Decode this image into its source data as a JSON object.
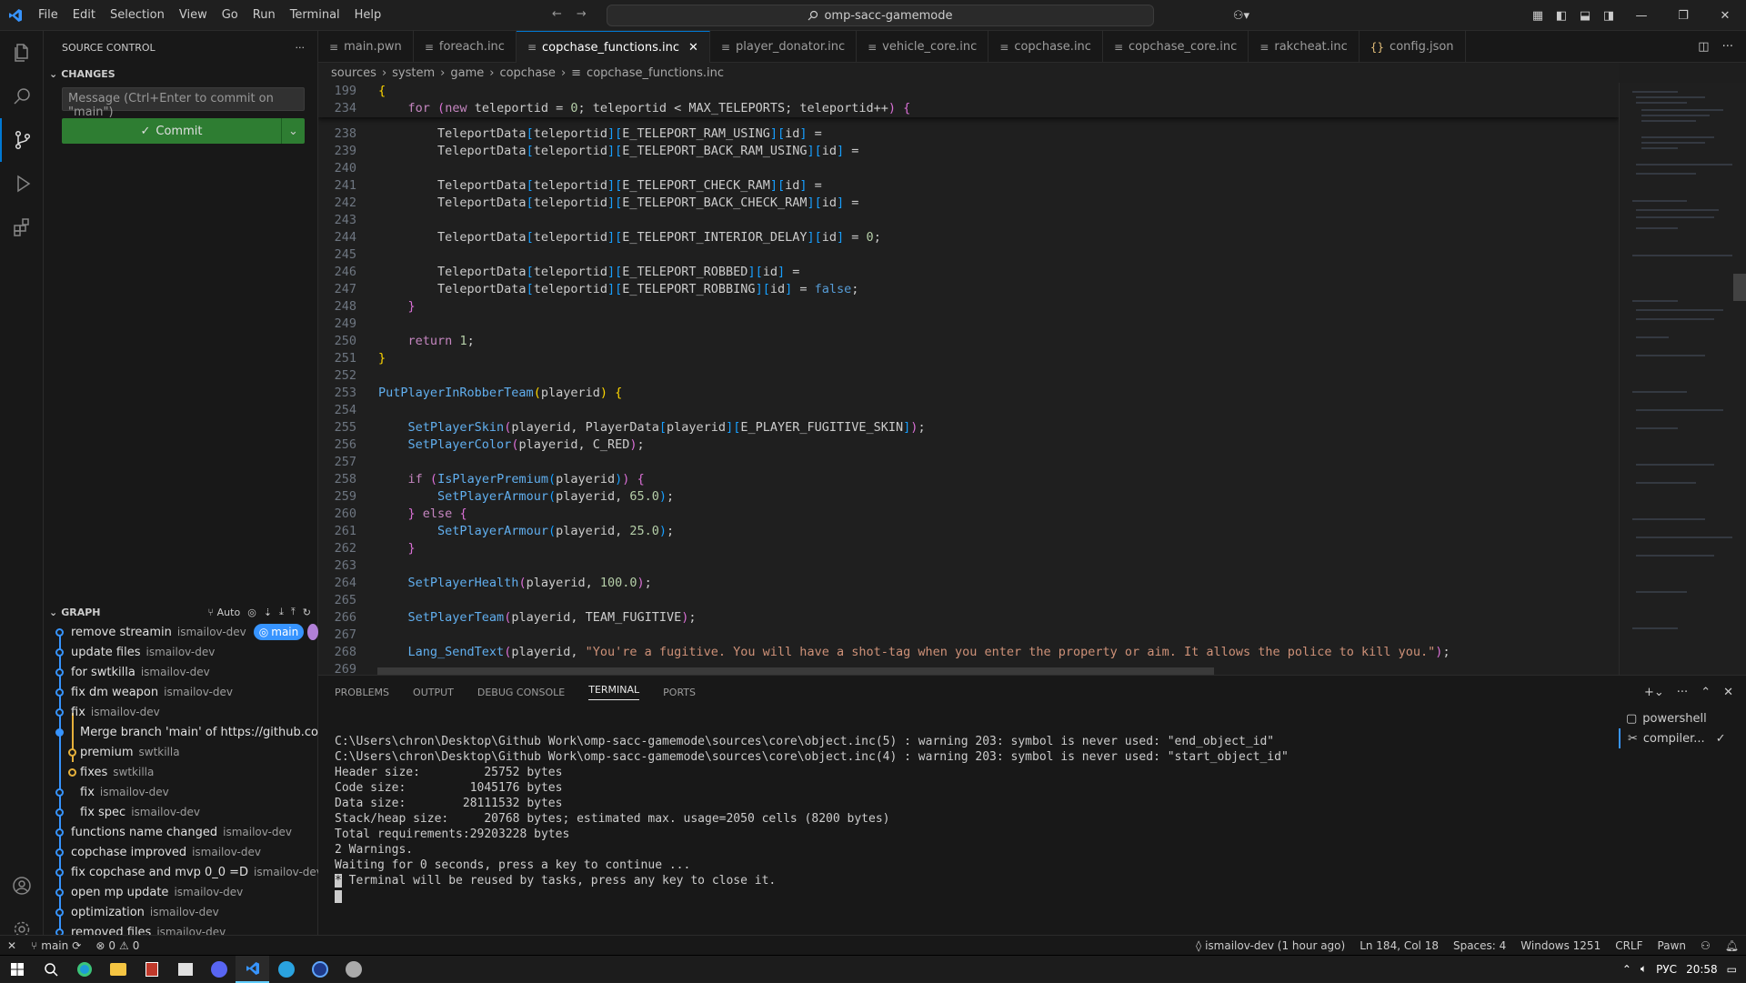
{
  "menu": [
    "File",
    "Edit",
    "Selection",
    "View",
    "Go",
    "Run",
    "Terminal",
    "Help"
  ],
  "search": {
    "text": "omp-sacc-gamemode"
  },
  "sidebar": {
    "title": "SOURCE CONTROL",
    "changes_label": "CHANGES",
    "message_placeholder": "Message (Ctrl+Enter to commit on \"main\")",
    "commit_label": "Commit",
    "graph_label": "GRAPH",
    "graph_auto": "Auto",
    "branch_badge": "main",
    "commits": [
      {
        "msg": "remove streamin",
        "author": "ismailov-dev"
      },
      {
        "msg": "update files",
        "author": "ismailov-dev"
      },
      {
        "msg": "for swtkilla",
        "author": "ismailov-dev"
      },
      {
        "msg": "fix dm weapon",
        "author": "ismailov-dev"
      },
      {
        "msg": "fix",
        "author": "ismailov-dev"
      },
      {
        "msg": "Merge branch 'main' of https://github.co...",
        "author": ""
      },
      {
        "msg": "premium",
        "author": "swtkilla"
      },
      {
        "msg": "fixes",
        "author": "swtkilla"
      },
      {
        "msg": "fix",
        "author": "ismailov-dev"
      },
      {
        "msg": "fix spec",
        "author": "ismailov-dev"
      },
      {
        "msg": "functions name changed",
        "author": "ismailov-dev"
      },
      {
        "msg": "copchase improved",
        "author": "ismailov-dev"
      },
      {
        "msg": "fix copchase and mvp 0_0 =D",
        "author": "ismailov-dev"
      },
      {
        "msg": "open mp update",
        "author": "ismailov-dev"
      },
      {
        "msg": "optimization",
        "author": "ismailov-dev"
      },
      {
        "msg": "removed files",
        "author": "ismailov-dev"
      }
    ]
  },
  "tabs": [
    {
      "label": "main.pwn",
      "icon": "≡"
    },
    {
      "label": "foreach.inc",
      "icon": "≡"
    },
    {
      "label": "copchase_functions.inc",
      "icon": "≡",
      "active": true
    },
    {
      "label": "player_donator.inc",
      "icon": "≡"
    },
    {
      "label": "vehicle_core.inc",
      "icon": "≡"
    },
    {
      "label": "copchase.inc",
      "icon": "≡"
    },
    {
      "label": "copchase_core.inc",
      "icon": "≡"
    },
    {
      "label": "rakcheat.inc",
      "icon": "≡"
    },
    {
      "label": "config.json",
      "icon": "{}"
    }
  ],
  "breadcrumb": [
    "sources",
    "system",
    "game",
    "copchase",
    "copchase_functions.inc"
  ],
  "panel": {
    "tabs": [
      "PROBLEMS",
      "OUTPUT",
      "DEBUG CONSOLE",
      "TERMINAL",
      "PORTS"
    ],
    "terminal_lines": [
      "C:\\Users\\chron\\Desktop\\Github Work\\omp-sacc-gamemode\\sources\\core\\object.inc(5) : warning 203: symbol is never used: \"end_object_id\"",
      "C:\\Users\\chron\\Desktop\\Github Work\\omp-sacc-gamemode\\sources\\core\\object.inc(4) : warning 203: symbol is never used: \"start_object_id\"",
      "Header size:         25752 bytes",
      "Code size:         1045176 bytes",
      "Data size:        28111532 bytes",
      "Stack/heap size:     20768 bytes; estimated max. usage=2050 cells (8200 bytes)",
      "Total requirements:29203228 bytes",
      "",
      "2 Warnings.",
      "",
      "Waiting for 0 seconds, press a key to continue ...",
      " Terminal will be reused by tasks, press any key to close it."
    ],
    "terminals": [
      "powershell",
      "compiler..."
    ]
  },
  "status": {
    "branch": "main",
    "errors": "0",
    "warnings": "0",
    "blame": "ismailov-dev (1 hour ago)",
    "position": "Ln 184, Col 18",
    "spaces": "Spaces: 4",
    "encoding": "Windows 1251",
    "eol": "CRLF",
    "language": "Pawn"
  },
  "taskbar": {
    "lang": "РУС",
    "time": "20:58"
  },
  "colors": {
    "accent": "#0078d4",
    "commit_green": "#2e7d32",
    "graph_blue": "#3794ff",
    "graph_yellow": "#e5b03b"
  }
}
